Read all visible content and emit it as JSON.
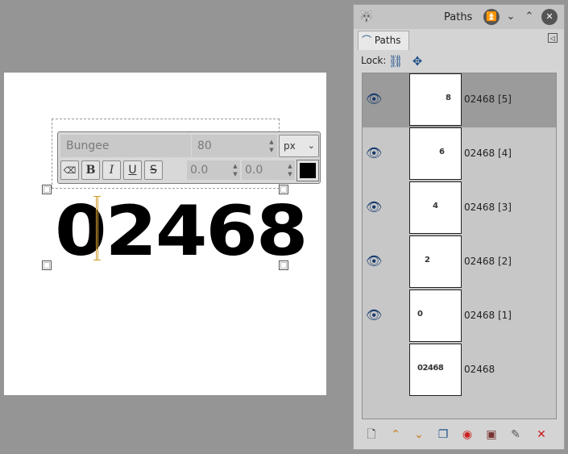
{
  "canvas": {
    "text_content": "02468"
  },
  "text_toolbar": {
    "font_name": "Bungee",
    "font_size": "80",
    "unit": "px",
    "baseline": "0.0",
    "kerning": "0.0",
    "buttons": {
      "clear": "⌫",
      "bold": "B",
      "italic": "I",
      "underline": "U",
      "strike": "S"
    },
    "color": "#000000"
  },
  "dock": {
    "title": "Paths",
    "tab_label": "Paths",
    "lock_label": "Lock:",
    "paths": [
      {
        "name": "02468 [5]",
        "thumb_text": "8",
        "visible": true,
        "selected": true
      },
      {
        "name": "02468 [4]",
        "thumb_text": "6",
        "visible": true,
        "selected": false
      },
      {
        "name": "02468 [3]",
        "thumb_text": "4",
        "visible": true,
        "selected": false
      },
      {
        "name": "02468 [2]",
        "thumb_text": "2",
        "visible": true,
        "selected": false
      },
      {
        "name": "02468 [1]",
        "thumb_text": "0",
        "visible": true,
        "selected": false
      },
      {
        "name": "02468",
        "thumb_text": "02468",
        "visible": false,
        "selected": false
      }
    ]
  },
  "icons": {
    "app": "gimp-icon",
    "eye": "👁",
    "delete_color": "#cc1a1a",
    "raise_color": "#c87a1e"
  }
}
